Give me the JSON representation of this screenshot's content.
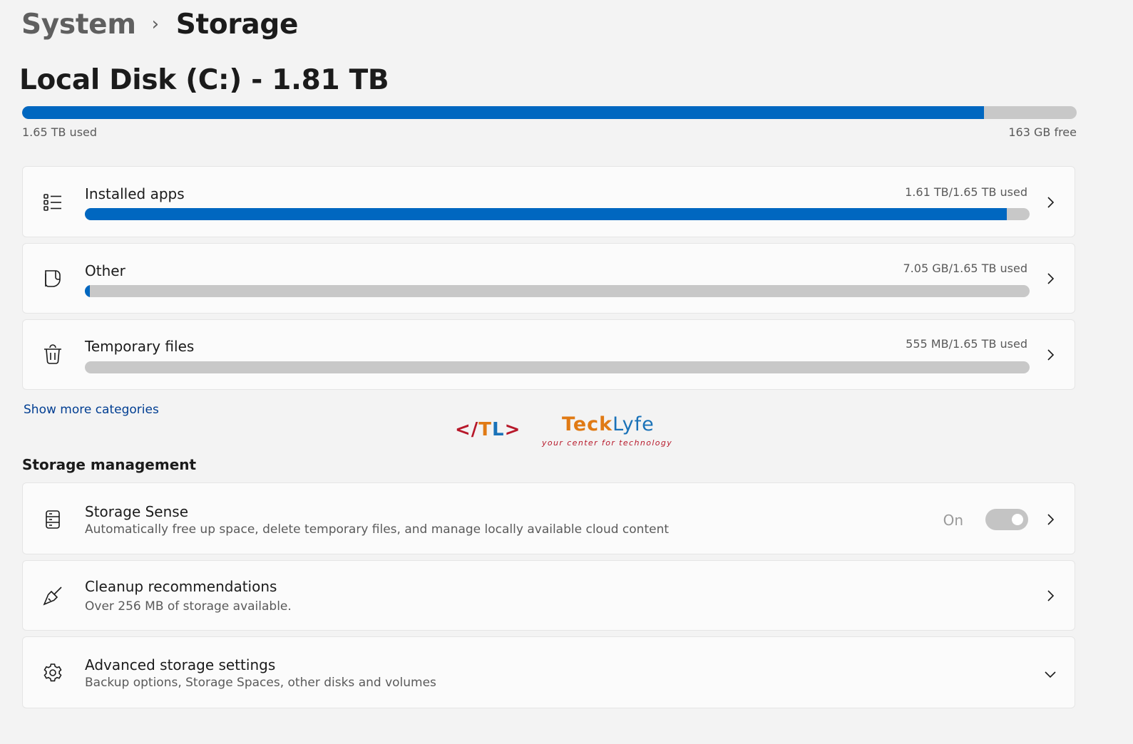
{
  "breadcrumb": {
    "parent": "System",
    "separator": "›",
    "current": "Storage"
  },
  "disk": {
    "title": "Local Disk (C:) - 1.81 TB",
    "used_label": "1.65 TB used",
    "free_label": "163 GB free",
    "used_fraction": 0.912
  },
  "categories": [
    {
      "label": "Installed apps",
      "usage": "1.61 TB/1.65 TB used",
      "fraction": 0.976,
      "icon": "list-icon"
    },
    {
      "label": "Other",
      "usage": "7.05 GB/1.65 TB used",
      "fraction": 0.005,
      "icon": "document-icon"
    },
    {
      "label": "Temporary files",
      "usage": "555 MB/1.65 TB used",
      "fraction": 0.0,
      "icon": "trash-icon"
    }
  ],
  "show_more": "Show more categories",
  "logo": {
    "tl_open": "</",
    "tl_t": "T",
    "tl_l": "L",
    "tl_close": ">",
    "brand_teck": "Teck",
    "brand_lyfe": "Lyfe",
    "tagline": "your center for technology"
  },
  "storage_management": {
    "heading": "Storage management",
    "items": [
      {
        "label": "Storage Sense",
        "description": "Automatically free up space, delete temporary files, and manage locally available cloud content",
        "toggle_state": "On",
        "icon": "storage-sense-icon"
      },
      {
        "label": "Cleanup recommendations",
        "description": "Over 256 MB of storage available.",
        "icon": "broom-icon"
      },
      {
        "label": "Advanced storage settings",
        "description": "Backup options, Storage Spaces, other disks and volumes",
        "icon": "gear-icon"
      }
    ]
  },
  "colors": {
    "accent": "#0067c0",
    "track": "#c8c8c8",
    "link": "#003e92"
  }
}
